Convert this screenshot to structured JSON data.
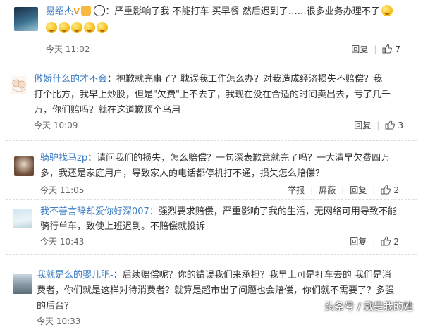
{
  "comments": [
    {
      "username": "易绍杰",
      "line1": "：严重影响了我  不能打车  买早餐  然后迟到了……很多业务办理不了",
      "time": "今天 11:02",
      "reply": "回复",
      "likes": "7"
    },
    {
      "username": "傲娇什么的才不会",
      "line1": "：抱歉就完事了？耽误我工作怎么办？对我造成经济损失不赔偿？我",
      "line2": "打个比方，我早上炒股，但是\"欠费\"上不去了，我现在没在合适的时间卖出去，亏了几千",
      "line3": "万，你们赔吗？就在这道歉顶个乌用",
      "time": "今天 10:09",
      "reply": "回复",
      "likes": "3"
    },
    {
      "username": "骑驴找马zp",
      "line1": "：请问我们的损失，怎么赔偿？一句深表歉意就完了吗？一大清早欠费四万",
      "line2": "多，我还是家庭用户，导致家人的电话都停机打不通，损失怎么赔偿？",
      "time": "今天 11:05",
      "report": "举报",
      "block": "屏蔽",
      "reply": "回复",
      "likes": "2"
    },
    {
      "username": "我不善言辞却爱你好深007",
      "line1": "：强烈要求赔偿，严重影响了我的生活，无网络可用导致不能",
      "line2": "骑行单车，致使上班迟到。不赔偿就投诉",
      "time": "今天 10:43",
      "reply": "回复",
      "likes": "2"
    },
    {
      "username": "我就是么的婴儿肥-",
      "line1": "：后续赔偿呢？你的错误我们来承担？我早上可是打车去的 我们是消",
      "line2": "费者，你们就是这样对待消费者？就算是超市出了问题也会赔偿，你们就不需要了？多强",
      "line3": "的后台？",
      "time": "今天 10:33"
    }
  ],
  "watermark": "头条号 / 戴是我的姓",
  "colors": {
    "username": "#3d7fc4",
    "text": "#333333",
    "meta": "#666666"
  }
}
